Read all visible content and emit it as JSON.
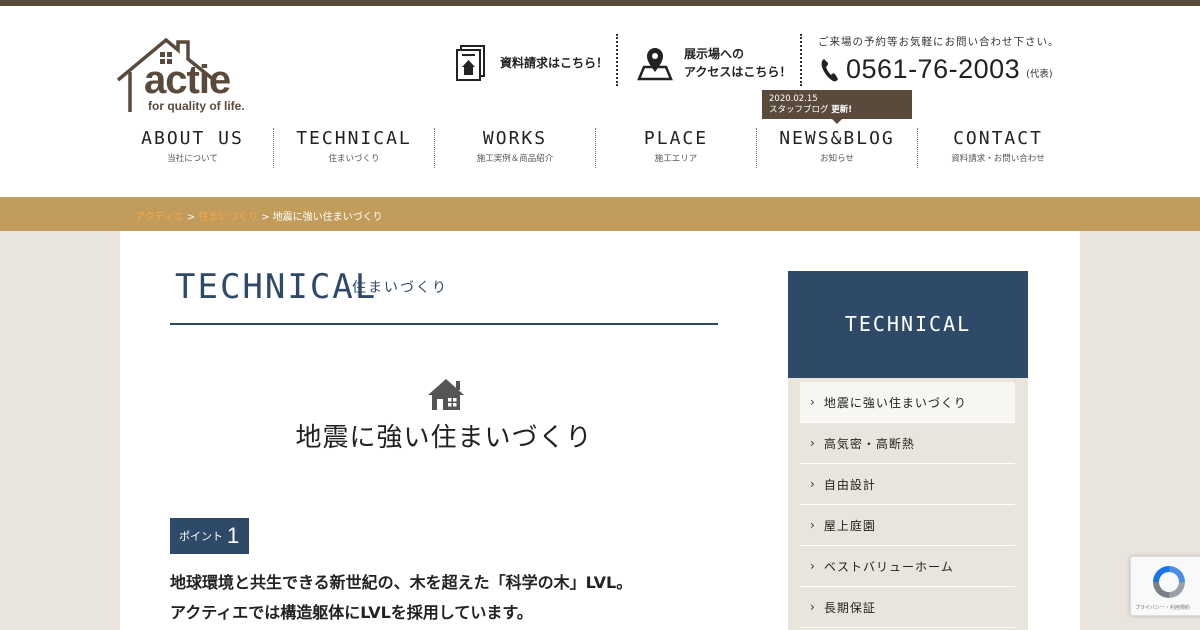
{
  "brand": {
    "name": "actie",
    "tagline": "for quality of life."
  },
  "header": {
    "docs_label": "資料請求はこちら！",
    "showroom_label_line1": "展示場への",
    "showroom_label_line2": "アクセスはこちら！",
    "contact_note": "ご来場の予約等お気軽にお問い合わせ下さい。",
    "phone": "0561-76-2003",
    "phone_note": "(代表)"
  },
  "news_badge": {
    "date": "2020.02.15",
    "text": "スタッフブログ",
    "new_label": "更新!"
  },
  "nav": [
    {
      "en": "ABOUT US",
      "ja": "当社について"
    },
    {
      "en": "TECHNICAL",
      "ja": "住まいづくり"
    },
    {
      "en": "WORKS",
      "ja": "施工実例＆商品紹介"
    },
    {
      "en": "PLACE",
      "ja": "施工エリア"
    },
    {
      "en": "NEWS&BLOG",
      "ja": "お知らせ"
    },
    {
      "en": "CONTACT",
      "ja": "資料請求・お問い合わせ"
    }
  ],
  "breadcrumb": {
    "items": [
      "アクティエ",
      "住まいづくり"
    ],
    "separator": ">",
    "current": "地震に強い住まいづくり"
  },
  "main": {
    "heading_en": "TECHNICAL",
    "heading_ja": "住まいづくり",
    "page_title": "地震に強い住まいづくり",
    "point_label": "ポイント",
    "point_number": "1",
    "point_line1": "地球環境と共生できる新世紀の、木を超えた「科学の木」LVL。",
    "point_line2": "アクティエでは構造躯体にLVLを採用しています。"
  },
  "sidebar": {
    "title": "TECHNICAL",
    "items": [
      "地震に強い住まいづくり",
      "高気密・高断熱",
      "自由設計",
      "屋上庭園",
      "ベストバリューホーム",
      "長期保証"
    ]
  },
  "recaptcha": {
    "label": "プライバシー・利用規約"
  },
  "colors": {
    "brown": "#5a4a3c",
    "navy": "#2f4a68",
    "gold": "#c29c5a",
    "beige": "#e9e5dc",
    "orange_link": "#f7a54a"
  }
}
